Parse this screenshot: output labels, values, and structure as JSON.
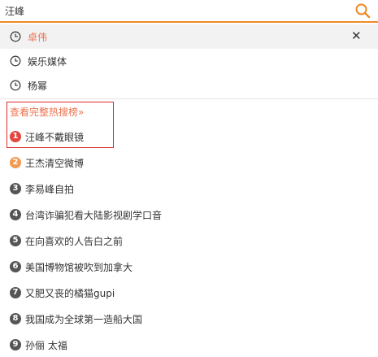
{
  "search": {
    "value": "汪峰",
    "icon": "search-icon",
    "accent": "#f08a24"
  },
  "history": [
    {
      "label": "卓伟",
      "highlight": true,
      "removable": true,
      "close_label": "✕"
    },
    {
      "label": "娱乐媒体",
      "highlight": false,
      "removable": false
    },
    {
      "label": "杨幂",
      "highlight": false,
      "removable": false
    }
  ],
  "hot": {
    "more_label": "查看完整热搜榜»",
    "link_color": "#eb7350",
    "items": [
      {
        "rank": "1",
        "label": "汪峰不戴眼镜",
        "color": "#e2463f"
      },
      {
        "rank": "2",
        "label": "王杰清空微博",
        "color": "#f19b52"
      },
      {
        "rank": "3",
        "label": "李易峰自拍",
        "color": "#555555"
      },
      {
        "rank": "4",
        "label": "台湾诈骗犯看大陆影视剧学口音",
        "color": "#555555"
      },
      {
        "rank": "5",
        "label": "在向喜欢的人告白之前",
        "color": "#555555"
      },
      {
        "rank": "6",
        "label": "美国博物馆被吹到加拿大",
        "color": "#555555"
      },
      {
        "rank": "7",
        "label": "又肥又丧的橘猫gupi",
        "color": "#555555"
      },
      {
        "rank": "8",
        "label": "我国成为全球第一造船大国",
        "color": "#555555"
      },
      {
        "rank": "9",
        "label": "孙俪 太福",
        "color": "#555555"
      }
    ]
  }
}
